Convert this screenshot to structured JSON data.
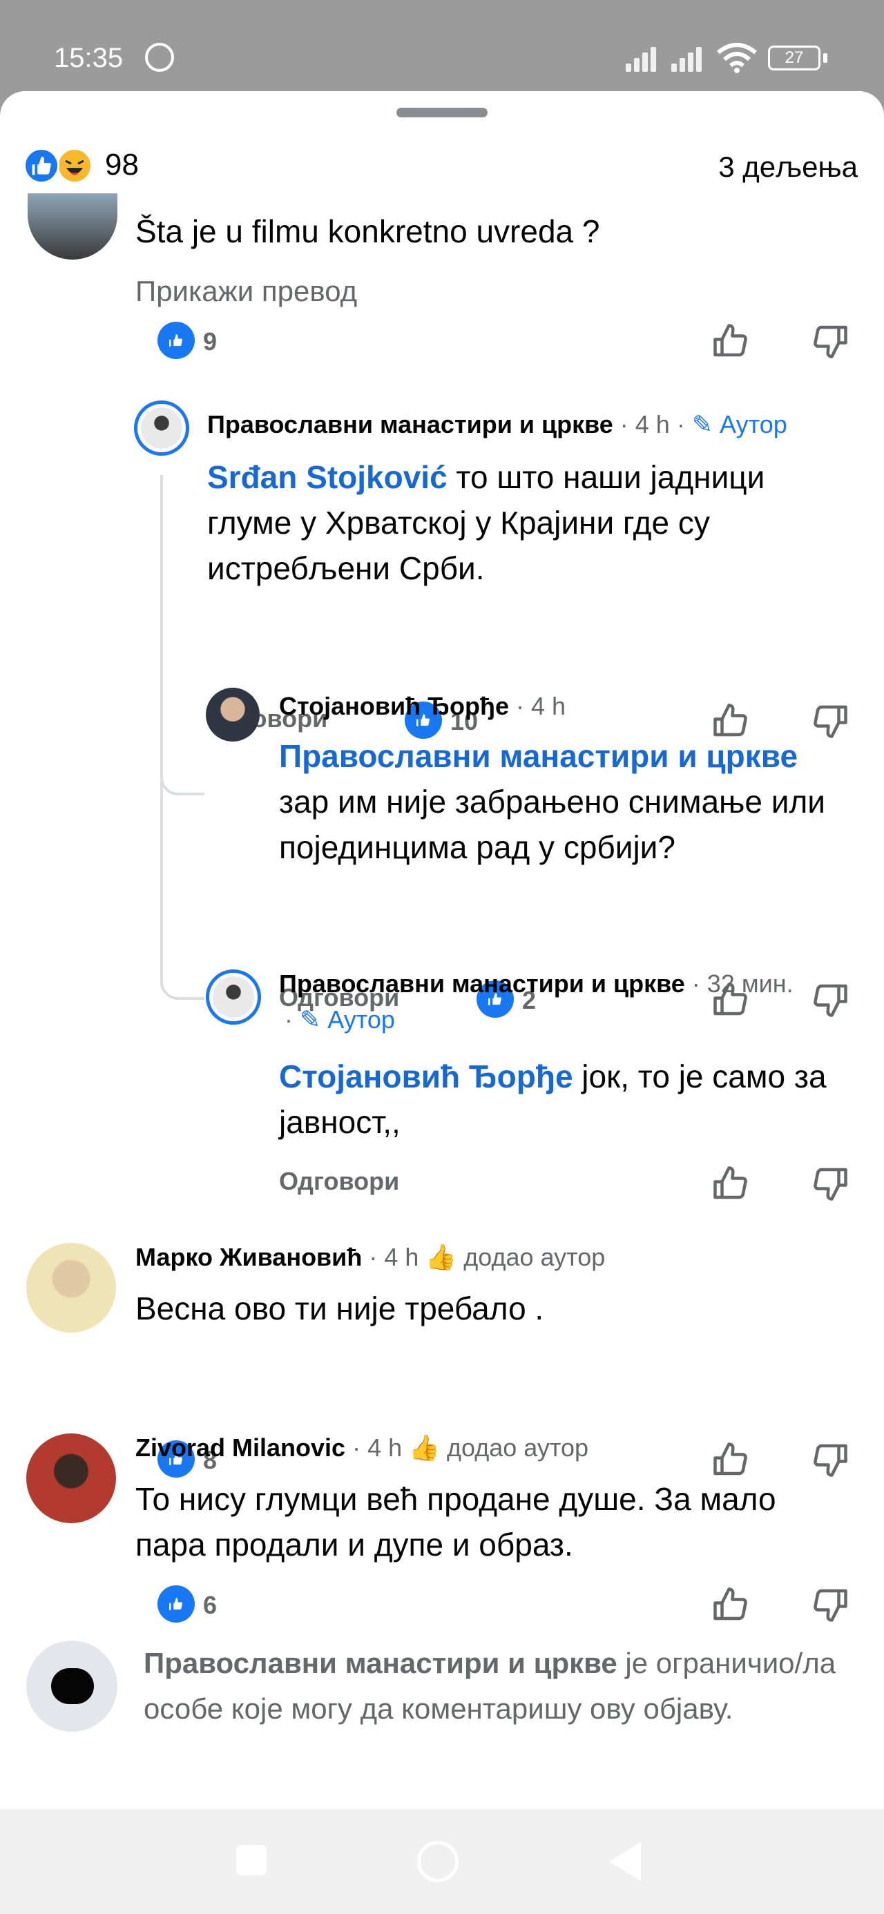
{
  "status_bar": {
    "time": "15:35",
    "battery": "27"
  },
  "header": {
    "reaction_count": "98",
    "shares": "3 дељења"
  },
  "comments": [
    {
      "text": "Šta je u filmu konkretno uvreda ?",
      "translate": "Прикажи превод",
      "likes": "9"
    },
    {
      "author": "Православни манастири и цркве",
      "time": "· 4 h ·",
      "badge": "Аутор",
      "mention": "Srđan Stojković",
      "text": " то што наши јадници глуме у Хрватској у Крајини где су истребљени Срби.",
      "reply": "Одговори",
      "likes": "10"
    },
    {
      "author": "Стојановић Ђорђе",
      "time": "· 4 h",
      "mention": "Православни манастири и цркве",
      "text": "зар им није забрањено снимање или појединцима рад у србији?",
      "reply": "Одговори",
      "likes": "2"
    },
    {
      "author": "Православни манастири и цркве",
      "time": "· 32 мин.",
      "time2": "·",
      "badge": "Аутор",
      "mention": "Стојановић Ђорђе",
      "text": " јок, то је само за јавност,,",
      "reply": "Одговори"
    },
    {
      "author": "Марко Живановић",
      "time": "· 4 h",
      "badge": "додао аутор",
      "text": "Весна ово ти није требало .",
      "likes": "8"
    },
    {
      "author": "Zivorad Milanovic",
      "time": "· 4 h",
      "badge": "додао аутор",
      "text": "То нису глумци већ продане душе. За мало пара продали и дупе и образ.",
      "likes": "6"
    }
  ],
  "restricted": {
    "page": "Православни манастири и цркве",
    "text": " је ограничио/ла особе које могу да коментаришу ову објаву."
  },
  "colors": {
    "accent": "#1877f2",
    "mention": "#1668d7",
    "muted": "#65676b"
  }
}
